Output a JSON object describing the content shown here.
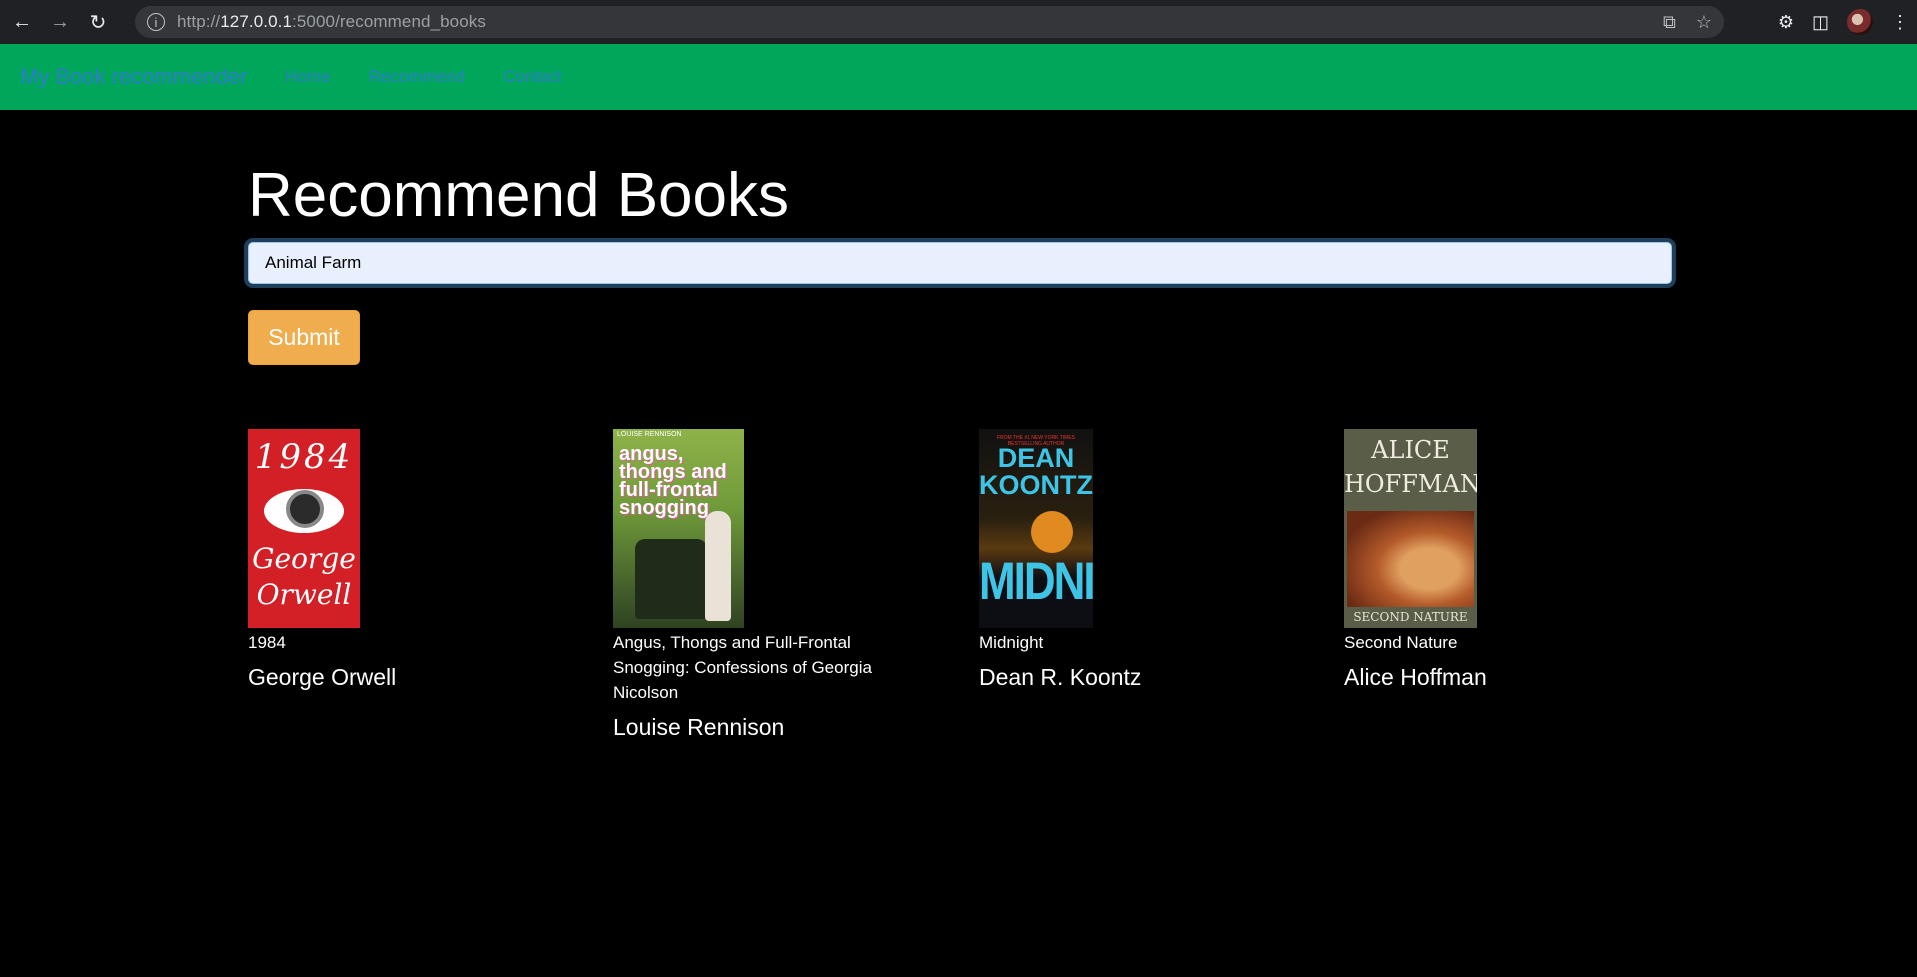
{
  "browser": {
    "url_prefix": "http://",
    "url_host": "127.0.0.1",
    "url_path": ":5000/recommend_books"
  },
  "navbar": {
    "brand": "My Book recommender",
    "links": [
      "Home",
      "Recommend",
      "Contact"
    ]
  },
  "main": {
    "title": "Recommend Books",
    "search_value": "Animal Farm",
    "submit_label": "Submit"
  },
  "books": [
    {
      "title": "1984",
      "author": "George Orwell",
      "cover_title": "1984",
      "cover_author": "George Orwell"
    },
    {
      "title": "Angus, Thongs and Full-Frontal Snogging: Confessions of Georgia Nicolson",
      "author": "Louise Rennison",
      "cover_top": "LOUISE RENNISON",
      "cover_title": "angus, thongs and full-frontal snogging"
    },
    {
      "title": "Midnight",
      "author": "Dean R. Koontz",
      "cover_top": "FROM THE #1 NEW YORK TIMES BESTSELLING AUTHOR",
      "cover_author": "DEAN KOONTZ",
      "cover_title": "MIDNIGHT"
    },
    {
      "title": "Second Nature",
      "author": "Alice Hoffman",
      "cover_author": "ALICE HOFFMAN",
      "cover_title": "SECOND NATURE"
    }
  ],
  "colors": {
    "navbar_bg": "#00a65a",
    "link": "#2a7fc9",
    "submit_bg": "#f0ad4e"
  }
}
